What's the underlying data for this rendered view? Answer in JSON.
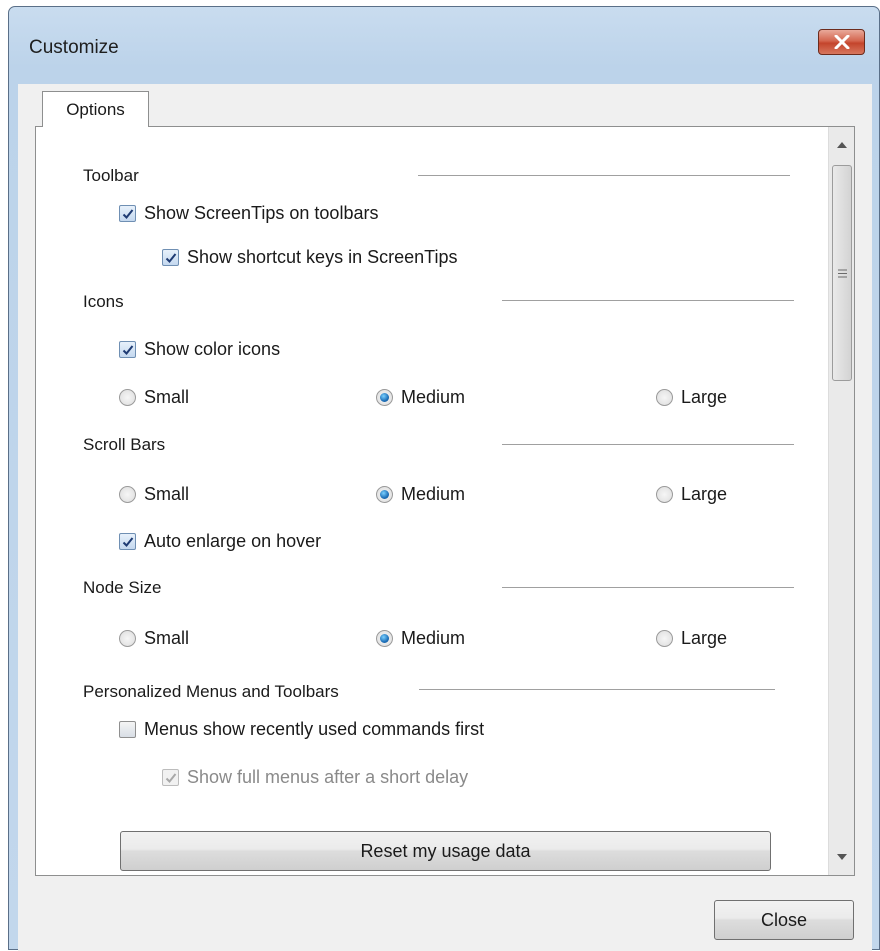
{
  "window": {
    "title": "Customize"
  },
  "tabs": [
    {
      "label": "Options"
    }
  ],
  "sections": {
    "toolbar": {
      "label": "Toolbar",
      "show_screentips": {
        "label": "Show ScreenTips on toolbars",
        "checked": true
      },
      "show_shortcut_keys": {
        "label": "Show shortcut keys in ScreenTips",
        "checked": true
      }
    },
    "icons": {
      "label": "Icons",
      "show_color_icons": {
        "label": "Show color icons",
        "checked": true
      },
      "size_options": [
        "Small",
        "Medium",
        "Large"
      ],
      "selected": "Medium"
    },
    "scroll_bars": {
      "label": "Scroll Bars",
      "size_options": [
        "Small",
        "Medium",
        "Large"
      ],
      "selected": "Medium",
      "auto_enlarge": {
        "label": "Auto enlarge on hover",
        "checked": true
      }
    },
    "node_size": {
      "label": "Node Size",
      "size_options": [
        "Small",
        "Medium",
        "Large"
      ],
      "selected": "Medium"
    },
    "personalized": {
      "label": "Personalized Menus and Toolbars",
      "recent_first": {
        "label": "Menus show recently used commands first",
        "checked": false
      },
      "full_menus": {
        "label": "Show full menus after a short delay",
        "checked": true,
        "disabled": true
      },
      "reset_button": "Reset my usage data"
    }
  },
  "footer": {
    "close_button": "Close"
  },
  "colors": {
    "title_bar": "#c2d7ec",
    "close_button": "#c4452c",
    "radio_selected": "#1d6fb8",
    "check_mark": "#1f3b73"
  }
}
